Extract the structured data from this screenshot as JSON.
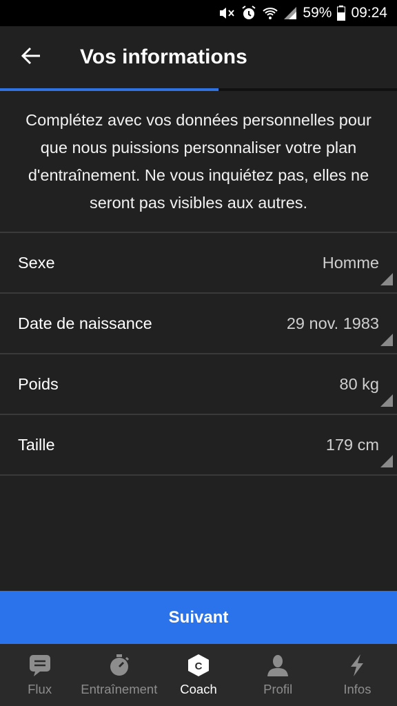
{
  "status_bar": {
    "battery": "59%",
    "time": "09:24"
  },
  "app_bar": {
    "title": "Vos informations",
    "progress_fraction": 0.55
  },
  "intro_text": "Complétez avec vos données personnelles pour que nous puissions personnaliser votre plan d'entraînement. Ne vous inquiétez pas, elles ne seront pas visibles aux autres.",
  "fields": [
    {
      "label": "Sexe",
      "value": "Homme"
    },
    {
      "label": "Date de naissance",
      "value": "29 nov. 1983"
    },
    {
      "label": "Poids",
      "value": "80 kg"
    },
    {
      "label": "Taille",
      "value": "179 cm"
    }
  ],
  "next_button": {
    "label": "Suivant"
  },
  "bottom_nav": {
    "items": [
      {
        "label": "Flux",
        "icon": "chat-icon"
      },
      {
        "label": "Entraînement",
        "icon": "stopwatch-icon"
      },
      {
        "label": "Coach",
        "icon": "coach-icon"
      },
      {
        "label": "Profil",
        "icon": "person-icon"
      },
      {
        "label": "Infos",
        "icon": "lightning-icon"
      }
    ],
    "active_index": 2
  },
  "colors": {
    "accent": "#2a73ea",
    "background": "#212121",
    "nav_inactive": "#8d8d8d"
  }
}
